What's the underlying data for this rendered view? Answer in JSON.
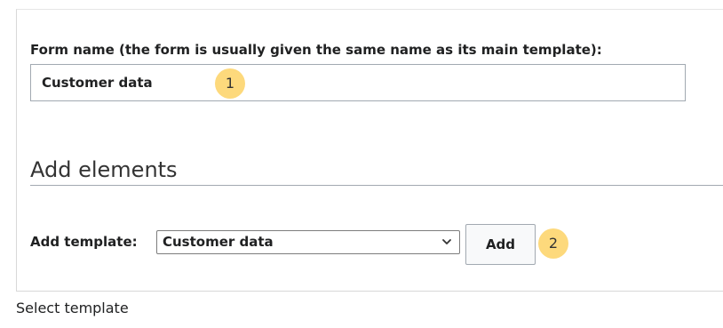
{
  "form_name": {
    "label": "Form name (the form is usually given the same name as its main template):",
    "value": "Customer data",
    "callout": "1"
  },
  "add_elements": {
    "heading": "Add elements",
    "template_label": "Add template:",
    "template_selected": "Customer data",
    "add_button_label": "Add",
    "callout": "2"
  },
  "caption": "Select template",
  "colors": {
    "callout_fill": "#fdd97c",
    "border": "#a2a9b1",
    "text": "#202122"
  },
  "icons": {
    "dropdown": "chevron-down-icon"
  }
}
